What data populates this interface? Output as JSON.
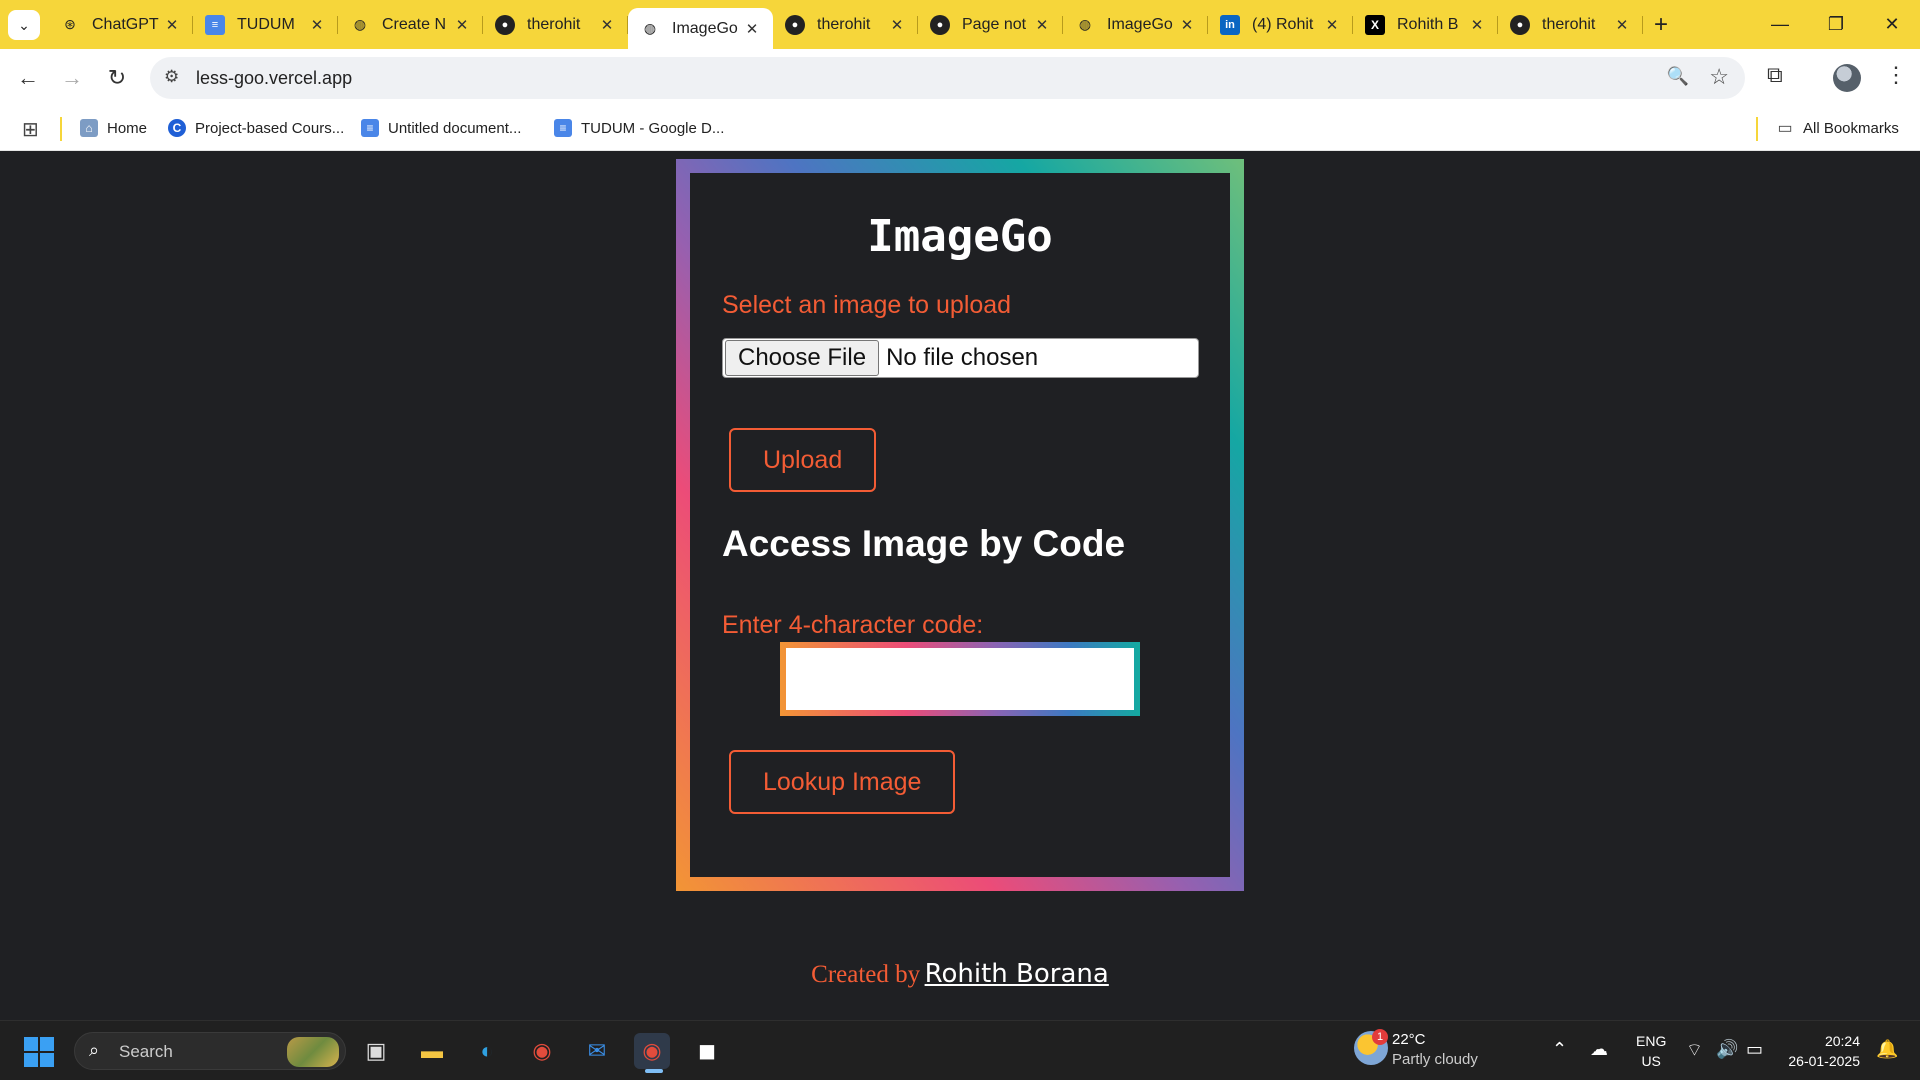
{
  "browser": {
    "tabs": [
      {
        "title": "ChatGPT",
        "icon": "chatgpt-icon"
      },
      {
        "title": "TUDUM",
        "icon": "google-docs-icon"
      },
      {
        "title": "Create N",
        "icon": "globe-icon"
      },
      {
        "title": "therohit",
        "icon": "github-icon"
      },
      {
        "title": "ImageGo",
        "icon": "globe-icon",
        "active": true
      },
      {
        "title": "therohit",
        "icon": "github-icon"
      },
      {
        "title": "Page not",
        "icon": "github-icon"
      },
      {
        "title": "ImageGo",
        "icon": "globe-icon"
      },
      {
        "title": "(4) Rohit",
        "icon": "linkedin-icon"
      },
      {
        "title": "Rohith B",
        "icon": "x-icon"
      },
      {
        "title": "therohit",
        "icon": "github-icon"
      }
    ],
    "url": "less-goo.vercel.app",
    "bookmarks": [
      {
        "label": "Home"
      },
      {
        "label": "Project-based Cours..."
      },
      {
        "label": "Untitled document..."
      },
      {
        "label": "TUDUM - Google D..."
      }
    ],
    "all_bookmarks": "All Bookmarks",
    "accent_color": "#f6d63a"
  },
  "app": {
    "title": "ImageGo",
    "upload_label": "Select an image to upload",
    "choose_file": "Choose File",
    "no_file": "No file chosen",
    "upload_button": "Upload",
    "access_title": "Access Image by Code",
    "code_label": "Enter 4-character code:",
    "code_value": "",
    "lookup_button": "Lookup Image",
    "footer_prefix": "Created by",
    "footer_name": "Rohith Borana",
    "accent_color": "#f35c35",
    "background_color": "#1f2023"
  },
  "taskbar": {
    "search_placeholder": "Search",
    "weather_temp": "22°C",
    "weather_desc": "Partly cloudy",
    "weather_badge": "1",
    "lang_line1": "ENG",
    "lang_line2": "US",
    "time": "20:24",
    "date": "26-01-2025"
  }
}
